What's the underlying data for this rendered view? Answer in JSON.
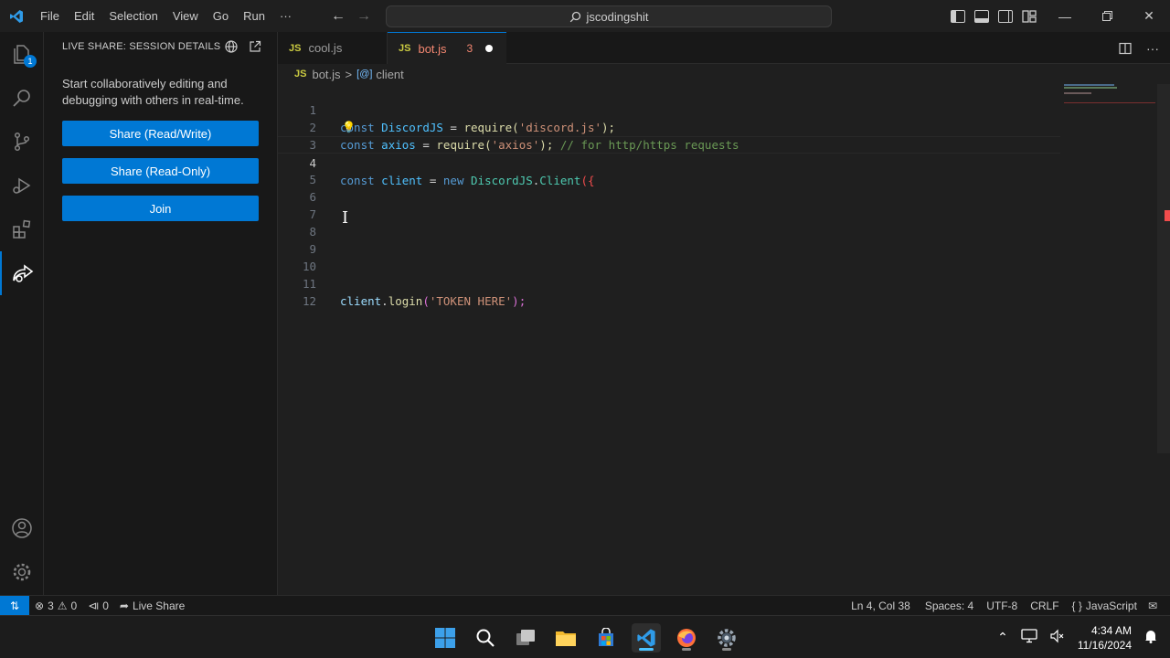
{
  "titlebar": {
    "menu": [
      "File",
      "Edit",
      "Selection",
      "View",
      "Go",
      "Run",
      "···"
    ],
    "search_text": "jscodingshit"
  },
  "activity": {
    "explorer_badge": "1"
  },
  "sidebar": {
    "title": "LIVE SHARE: SESSION DETAILS",
    "description": "Start collaboratively editing and debugging with others in real-time.",
    "buttons": [
      "Share (Read/Write)",
      "Share (Read-Only)",
      "Join"
    ]
  },
  "tabs": [
    {
      "icon": "JS",
      "name": "cool.js"
    },
    {
      "icon": "JS",
      "name": "bot.js",
      "problems": "3"
    }
  ],
  "breadcrumb": {
    "icon": "JS",
    "file": "bot.js",
    "separator": ">",
    "symbol_icon": "[@]",
    "symbol": "client"
  },
  "editor": {
    "line_numbers": [
      "1",
      "2",
      "3",
      "4",
      "5",
      "6",
      "7",
      "8",
      "9",
      "10",
      "11",
      "12"
    ],
    "line1": {
      "kw": "const",
      "var": "DiscordJS",
      "op": " = ",
      "fn": "require",
      "open": "(",
      "str": "'discord.js'",
      "close": ");"
    },
    "line2": {
      "kw": "const",
      "var": "axios",
      "op": " = ",
      "fn": "require",
      "open": "(",
      "str": "'axios'",
      "close": ");",
      "comment": "// for http/https requests"
    },
    "line4": {
      "kw": "const",
      "var": "client",
      "op": " = ",
      "kw2": "new",
      "obj": "DiscordJS",
      "dot": ".",
      "cls": "Client",
      "open": "({"
    },
    "line11": {
      "obj": "client",
      "dot": ".",
      "fn": "login",
      "open": "(",
      "str": "'TOKEN HERE'",
      "close": ");"
    }
  },
  "statusbar": {
    "errors": "3",
    "warnings": "0",
    "ports": "0",
    "live_share": "Live Share",
    "position": "Ln 4, Col 38",
    "spaces": "Spaces: 4",
    "encoding": "UTF-8",
    "eol": "CRLF",
    "language": "JavaScript"
  },
  "taskbar": {
    "time": "4:34 AM",
    "date": "11/16/2024"
  },
  "colors": {
    "accent": "#0078d4",
    "error": "#f14c4c"
  }
}
